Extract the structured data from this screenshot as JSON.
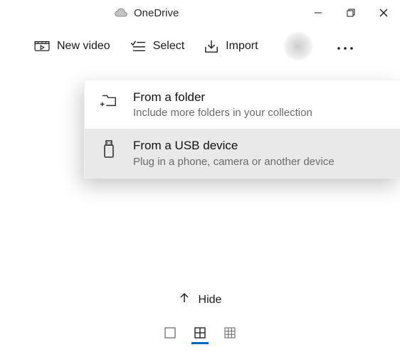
{
  "window": {
    "title": "OneDrive"
  },
  "toolbar": {
    "new_video": "New video",
    "select": "Select",
    "import": "Import"
  },
  "import_menu": {
    "folder": {
      "title": "From a folder",
      "subtitle": "Include more folders in your collection"
    },
    "usb": {
      "title": "From a USB device",
      "subtitle": "Plug in a phone, camera or another device"
    }
  },
  "hide_label": "Hide"
}
